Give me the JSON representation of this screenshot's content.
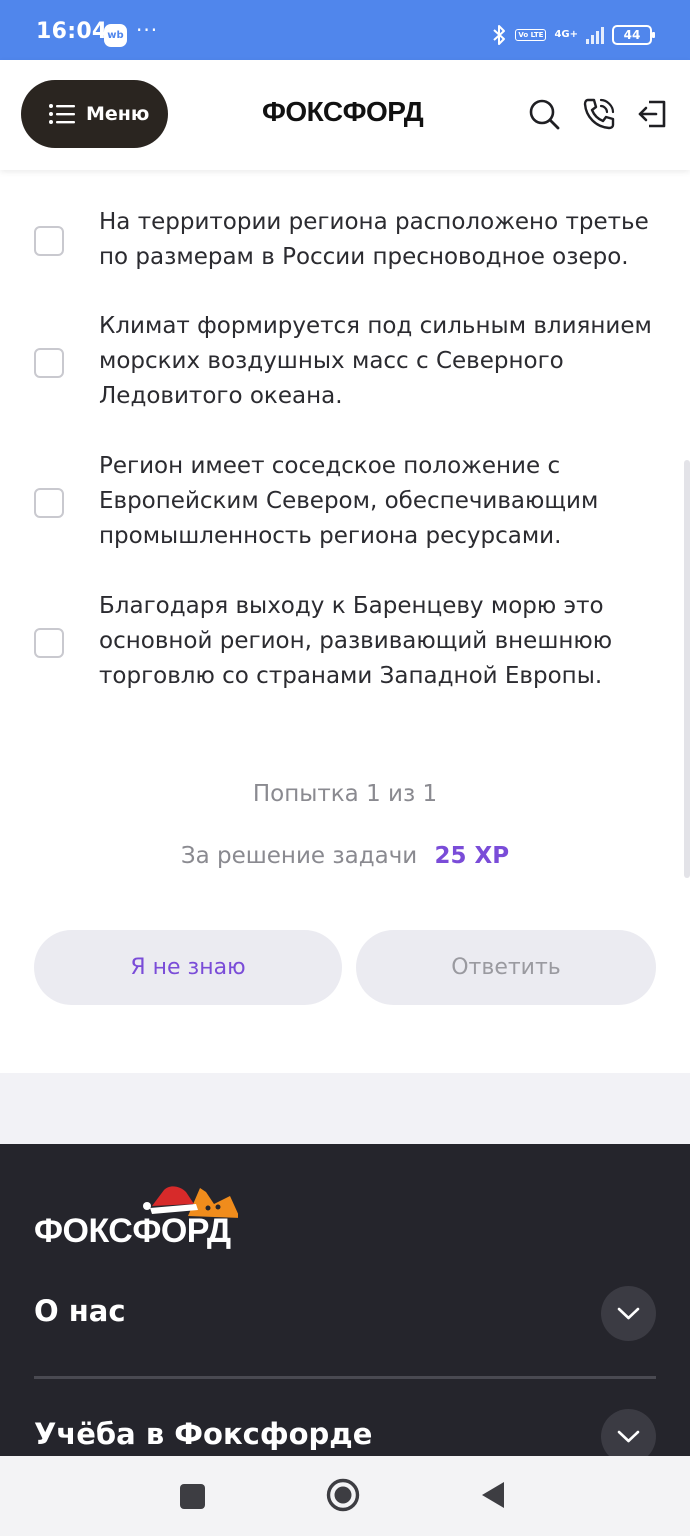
{
  "status_bar": {
    "time": "16:04",
    "app_badge": "wb",
    "more": "···",
    "volte": "Vo LTE",
    "network": "4G+",
    "battery": "44",
    "icons": [
      "bluetooth-icon",
      "volte-icon",
      "signal-icon",
      "battery-icon"
    ]
  },
  "header": {
    "menu_label": "Меню",
    "logo": "ФОКСФОРД",
    "icons": [
      "search-icon",
      "phone-icon",
      "logout-icon"
    ]
  },
  "question": {
    "options": [
      {
        "text": "На территории региона расположено третье по размерам в России пресноводное озеро.",
        "checked": false
      },
      {
        "text": "Климат формируется под сильным влиянием морских воздушных масс с Северного Ледовитого океана.",
        "checked": false
      },
      {
        "text": "Регион имеет соседское положение с Европейским Севером, обеспечивающим промышленность региона ресурсами.",
        "checked": false
      },
      {
        "text": "Благодаря выходу к Баренцеву морю это основной регион, развивающий внешнюю торговлю со странами Западной Европы.",
        "checked": false
      }
    ],
    "attempt": "Попытка 1 из 1",
    "reward_label": "За решение задачи",
    "reward_xp": "25 XP",
    "dont_know_button": "Я не знаю",
    "answer_button": "Ответить"
  },
  "footer": {
    "logo": "ФОКСФОРД",
    "sections": [
      {
        "title": "О нас",
        "expanded": false
      },
      {
        "title": "Учёба в Фоксфорде",
        "expanded": false
      }
    ]
  },
  "colors": {
    "status_bar": "#5086ec",
    "accent": "#7a4cd8",
    "footer_bg": "#25252c",
    "menu_button": "#2a2520"
  },
  "nav_bar": {
    "icons": [
      "recent-apps-icon",
      "home-icon",
      "back-icon"
    ]
  }
}
